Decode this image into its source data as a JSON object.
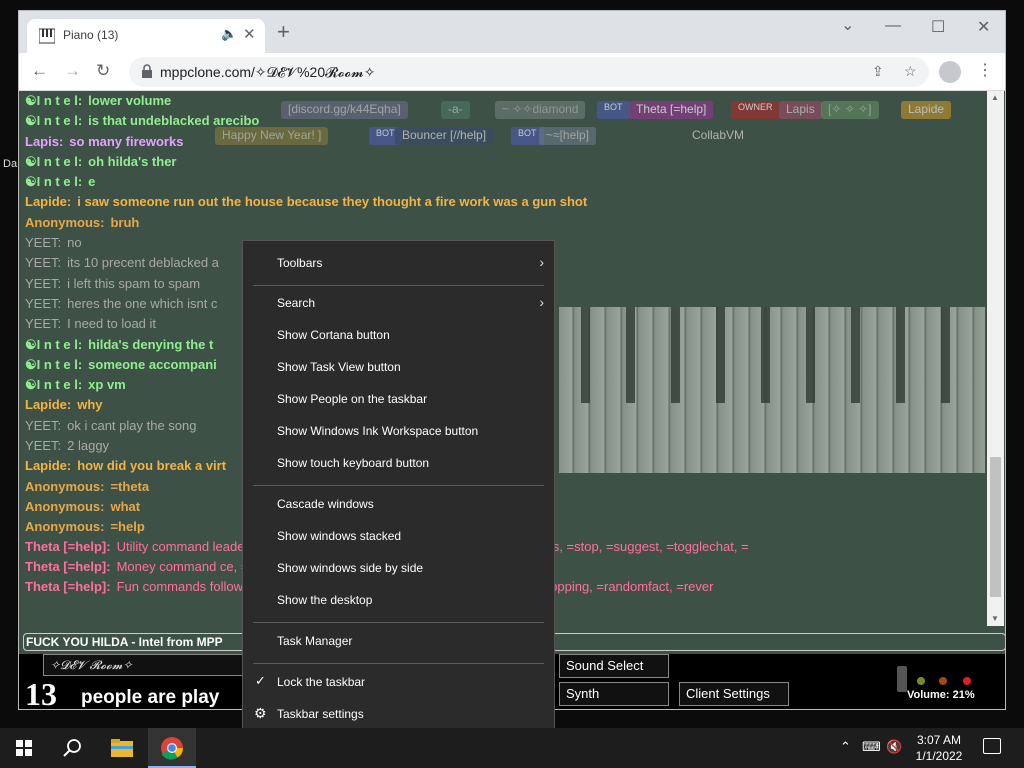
{
  "desktop": {
    "label": "Da"
  },
  "browser": {
    "tab": {
      "title": "Piano (13)"
    },
    "url": "mppclone.com/✧𝓓𝓔𝓥%20𝓡𝓸𝓸𝓶✧",
    "controls": {
      "minimize": "—",
      "maximize": "☐",
      "close": "✕",
      "dropdown": "⌄",
      "new_tab": "+"
    }
  },
  "namebars": {
    "row1": [
      "[discord.gg/k44Eqha]",
      "-a-",
      "~ ✧✧diamond",
      "BOT",
      "Theta [=help]",
      "OWNER",
      "Lapis",
      "[✧ ✧ ✧]",
      "Lapide"
    ],
    "row2": [
      "Happy New Year! ]",
      "BOT",
      "Bouncer [//help]",
      "BOT",
      "~≈[help]",
      "CollabVM"
    ]
  },
  "chat": [
    {
      "nick": "☯I n t e l:",
      "text": "lower volume",
      "color": "#90ee90"
    },
    {
      "nick": "☯I n t e l:",
      "text": "is that undeblacked arecibo",
      "color": "#90ee90"
    },
    {
      "nick": "Lapis:",
      "text": "so many fireworks",
      "color": "#e6a0ff"
    },
    {
      "nick": "☯I n t e l:",
      "text": "oh hilda's ther",
      "color": "#90ee90"
    },
    {
      "nick": "☯I n t e l:",
      "text": "e",
      "color": "#90ee90"
    },
    {
      "nick": "Lapide:",
      "text": "i saw someone run out the house because they thought a fire work was a gun shot",
      "color": "#f5b342"
    },
    {
      "nick": "Anonymous:",
      "text": "bruh",
      "color": "#e6a84a"
    },
    {
      "nick": "YEET:",
      "text": "no",
      "color": "#a9a9a9"
    },
    {
      "nick": "YEET:",
      "text": "its 10 precent deblacked a",
      "color": "#a9a9a9"
    },
    {
      "nick": "YEET:",
      "text": "i left this spam to spam",
      "color": "#a9a9a9"
    },
    {
      "nick": "YEET:",
      "text": "heres the one which isnt c",
      "color": "#a9a9a9"
    },
    {
      "nick": "YEET:",
      "text": "I need to load it",
      "color": "#a9a9a9"
    },
    {
      "nick": "☯I n t e l:",
      "text": "hilda's denying the t",
      "color": "#90ee90"
    },
    {
      "nick": "☯I n t e l:",
      "text": "someone accompani",
      "color": "#90ee90"
    },
    {
      "nick": "☯I n t e l:",
      "text": "xp vm",
      "color": "#90ee90"
    },
    {
      "nick": "Lapide:",
      "text": "why",
      "color": "#f5b342"
    },
    {
      "nick": "YEET:",
      "text": "ok i cant play the song",
      "color": "#a9a9a9"
    },
    {
      "nick": "YEET:",
      "text": "2 laggy",
      "color": "#a9a9a9"
    },
    {
      "nick": "Lapide:",
      "text": "how did you break a virt",
      "color": "#f5b342"
    },
    {
      "nick": "Anonymous:",
      "text": "=theta",
      "color": "#e6a84a"
    },
    {
      "nick": "Anonymous:",
      "text": "what",
      "color": "#e6a84a"
    },
    {
      "nick": "Anonymous:",
      "text": "=help",
      "color": "#e6a84a"
    }
  ],
  "chat_wrapped": [
    {
      "nick": "Theta [=help]:",
      "text": "Utility command                                                                    leaderboard, =namehistory, =pplcountavg, =roominfo, =stats, =stop, =suggest, =togglechat, =",
      "color": "#ff6fa0"
    },
    {
      "nick": "Theta [=help]:",
      "text": "Money command                                                                    ce, =pay, =sell, =typerace, =use.",
      "color": "#ff6fa0"
    },
    {
      "nick": "Theta [=help]:",
      "text": "Fun commands                                                                     follow, =cleardescription, =coinflip, =follow, =hug, =kiss, =mppping, =randomfact, =rever",
      "color": "#ff6fa0"
    }
  ],
  "chat_input": {
    "value": "FUCK YOU HILDA - Intel from MPP"
  },
  "bottom": {
    "room": "✧𝓓𝓔𝓥 𝓡𝓸𝓸𝓶✧",
    "count": "13",
    "count_text": "people are play",
    "sound_select": "Sound Select",
    "synth": "Synth",
    "client_settings": "Client Settings",
    "volume": "Volume: 21%"
  },
  "context_menu": {
    "items": [
      {
        "label": "Toolbars",
        "submenu": true
      },
      {
        "label": "Search",
        "submenu": true
      },
      {
        "label": "Show Cortana button"
      },
      {
        "label": "Show Task View button"
      },
      {
        "label": "Show People on the taskbar"
      },
      {
        "label": "Show Windows Ink Workspace button"
      },
      {
        "label": "Show touch keyboard button"
      },
      {
        "label": "Cascade windows"
      },
      {
        "label": "Show windows stacked"
      },
      {
        "label": "Show windows side by side"
      },
      {
        "label": "Show the desktop"
      },
      {
        "label": "Task Manager"
      },
      {
        "label": "Lock the taskbar",
        "checked": true
      },
      {
        "label": "Taskbar settings"
      }
    ]
  },
  "taskbar": {
    "time": "3:07 AM",
    "date": "1/1/2022",
    "icons": [
      "start-icon",
      "search-icon",
      "file-explorer-icon",
      "chrome-icon"
    ]
  }
}
